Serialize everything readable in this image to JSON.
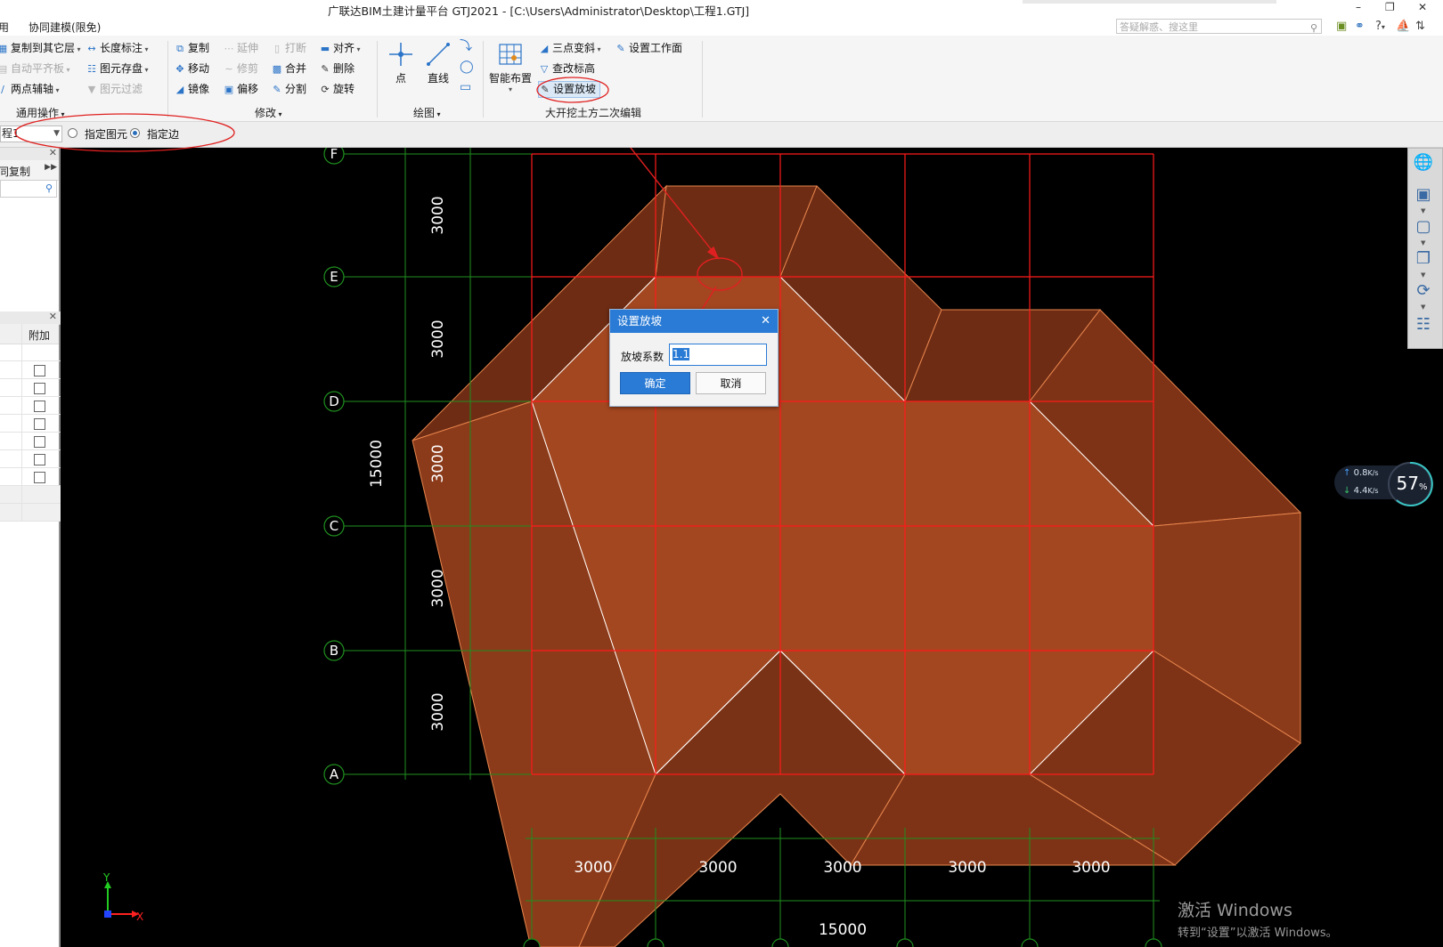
{
  "titlebar": {
    "title": "广联达BIM土建计量平台 GTJ2021 - [C:\\Users\\Administrator\\Desktop\\工程1.GTJ]",
    "menu_items": [
      "用",
      "协同建模(限免)"
    ],
    "search_placeholder": "答疑解惑、搜这里",
    "help": "?"
  },
  "ribbon": {
    "general": {
      "copy_to_floor": "复制到其它层",
      "auto_align": "自动平齐板",
      "two_point_axis": "两点辅轴",
      "length_dim": "长度标注",
      "save_element": "图元存盘",
      "filter_element": "图元过滤",
      "group_label": "通用操作"
    },
    "modify": {
      "copy": "复制",
      "extend": "延伸",
      "break": "打断",
      "align": "对齐",
      "move": "移动",
      "trim": "修剪",
      "merge": "合并",
      "delete": "删除",
      "mirror": "镜像",
      "offset": "偏移",
      "split": "分割",
      "rotate": "旋转",
      "group_label": "修改"
    },
    "draw": {
      "point": "点",
      "line": "直线",
      "group_label": "绘图"
    },
    "excavation": {
      "smart_layout": "智能布置",
      "three_point_slope": "三点变斜",
      "set_workplane": "设置工作面",
      "check_elevation": "查改标高",
      "set_slope": "设置放坡",
      "group_label": "大开挖土方二次编辑"
    }
  },
  "optionbar": {
    "combo_value": "程1",
    "opt_element": "指定图元",
    "opt_edge": "指定边"
  },
  "leftpanel": {
    "copy_label": "同复制",
    "col_extra": "附加",
    "checkbox_rows": [
      false,
      false,
      false,
      false,
      false,
      false,
      false
    ]
  },
  "drawing": {
    "row_axes": [
      "F",
      "E",
      "D",
      "C",
      "B",
      "A"
    ],
    "row_spacings": [
      "3000",
      "3000",
      "3000",
      "3000",
      "3000"
    ],
    "row_total": "15000",
    "col_spacings": [
      "3000",
      "3000",
      "3000",
      "3000",
      "3000"
    ],
    "col_total": "15000",
    "axis_x": "X",
    "axis_y": "Y",
    "colors": {
      "grid_red": "#ff1a1a",
      "grid_green": "#1f8f1f",
      "slab_top": "#a34720",
      "slope_mid": "#8b3a1a",
      "slope_dark": "#6e2c14"
    }
  },
  "dialog": {
    "title": "设置放坡",
    "label": "放坡系数",
    "value": "1.1",
    "ok": "确定",
    "cancel": "取消"
  },
  "speed": {
    "up": "0.8",
    "down": "4.4",
    "unit": "K/s",
    "percent": "57",
    "percent_sign": "%"
  },
  "watermark": {
    "line1": "激活 Windows",
    "line2": "转到“设置”以激活 Windows。"
  }
}
